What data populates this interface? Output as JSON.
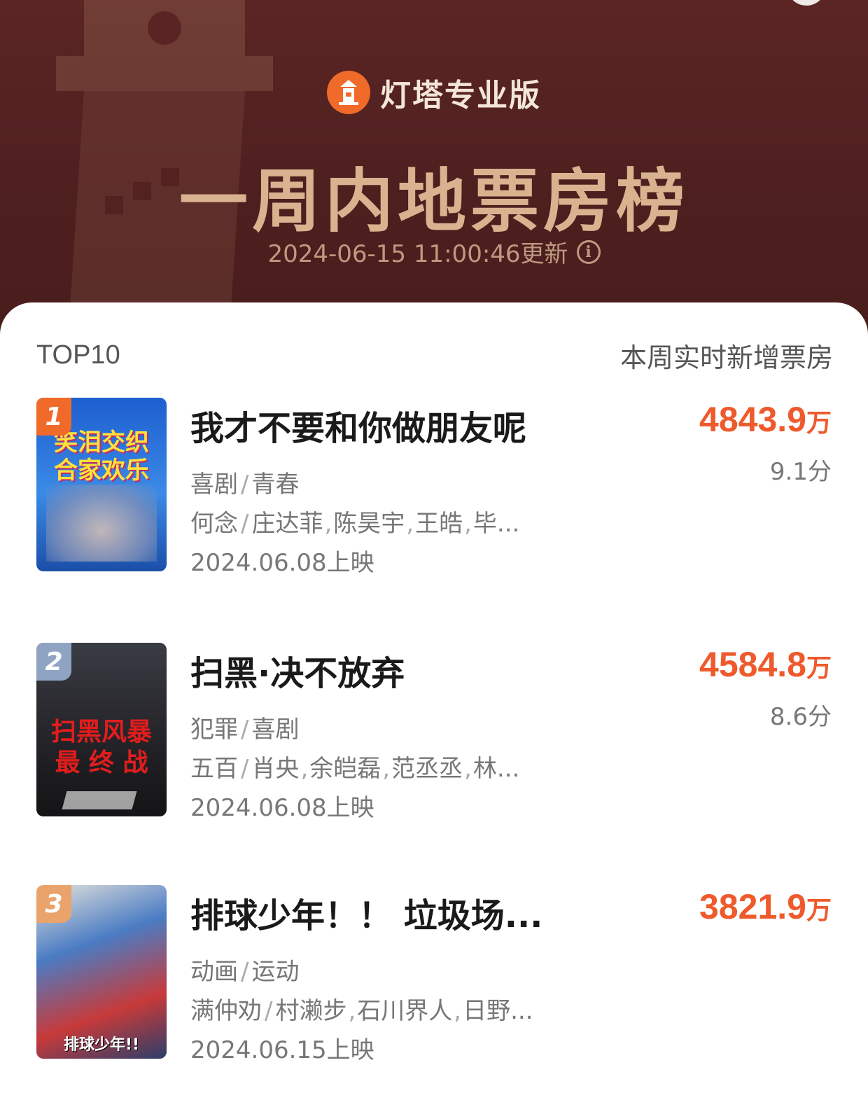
{
  "header": {
    "brand": "灯塔专业版",
    "title": "一周内地票房榜",
    "updated": "2024-06-15 11:00:46更新"
  },
  "list": {
    "top_label": "TOP10",
    "column_label": "本周实时新增票房"
  },
  "movies": [
    {
      "rank": "1",
      "title": "我才不要和你做朋友呢",
      "genres": [
        "喜剧",
        "青春"
      ],
      "director": "何念",
      "cast": [
        "庄达菲",
        "陈昊宇",
        "王皓",
        "毕..."
      ],
      "release": "2024.06.08上映",
      "box_office": "4843.9",
      "unit": "万",
      "score": "9.1分",
      "poster_text": [
        "笑泪交织",
        "合家欢乐"
      ],
      "poster_color": "#1f6fd6",
      "badge_color": "#f06a2a"
    },
    {
      "rank": "2",
      "title": "扫黑·决不放弃",
      "genres": [
        "犯罪",
        "喜剧"
      ],
      "director": "五百",
      "cast": [
        "肖央",
        "余皑磊",
        "范丞丞",
        "林..."
      ],
      "release": "2024.06.08上映",
      "box_office": "4584.8",
      "unit": "万",
      "score": "8.6分",
      "poster_text": [
        "扫黑风暴",
        "最 终 战"
      ],
      "poster_color": "#2a2a2e",
      "badge_color": "#8fa4c2"
    },
    {
      "rank": "3",
      "title": "排球少年！！ 垃圾场...",
      "genres": [
        "动画",
        "运动"
      ],
      "director": "满仲劝",
      "cast": [
        "村濑步",
        "石川界人",
        "日野..."
      ],
      "release": "2024.06.15上映",
      "box_office": "3821.9",
      "unit": "万",
      "score": "",
      "poster_text": [
        "排球少年!!"
      ],
      "poster_color": "#3d6fb0",
      "badge_color": "#e9a36b"
    }
  ]
}
